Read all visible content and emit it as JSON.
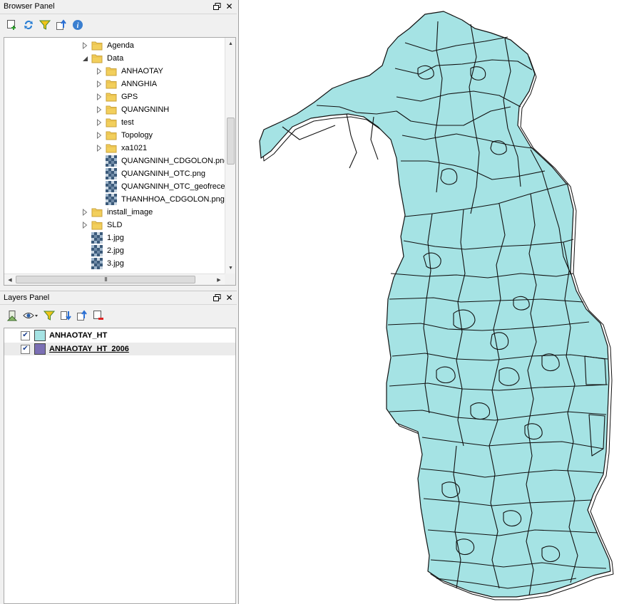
{
  "browser_panel": {
    "title": "Browser Panel",
    "float_icon": "float-icon",
    "close_icon": "close-icon",
    "tools": [
      "add-layer-icon",
      "refresh-icon",
      "filter-icon",
      "collapse-all-icon",
      "info-icon"
    ],
    "tree": [
      {
        "label": "Agenda",
        "type": "folder",
        "depth": 0,
        "expander": "collapsed"
      },
      {
        "label": "Data",
        "type": "folder",
        "depth": 0,
        "expander": "expanded"
      },
      {
        "label": "ANHAOTAY",
        "type": "folder",
        "depth": 1,
        "expander": "collapsed"
      },
      {
        "label": "ANNGHIA",
        "type": "folder",
        "depth": 1,
        "expander": "collapsed"
      },
      {
        "label": "GPS",
        "type": "folder",
        "depth": 1,
        "expander": "collapsed"
      },
      {
        "label": "QUANGNINH",
        "type": "folder",
        "depth": 1,
        "expander": "collapsed"
      },
      {
        "label": "test",
        "type": "folder",
        "depth": 1,
        "expander": "collapsed"
      },
      {
        "label": "Topology",
        "type": "folder",
        "depth": 1,
        "expander": "collapsed"
      },
      {
        "label": "xa1021",
        "type": "folder",
        "depth": 1,
        "expander": "collapsed"
      },
      {
        "label": "QUANGNINH_CDGOLON.png",
        "type": "raster",
        "depth": 1,
        "expander": "none"
      },
      {
        "label": "QUANGNINH_OTC.png",
        "type": "raster",
        "depth": 1,
        "expander": "none"
      },
      {
        "label": "QUANGNINH_OTC_geofrecen",
        "type": "raster",
        "depth": 1,
        "expander": "none"
      },
      {
        "label": "THANHHOA_CDGOLON.png",
        "type": "raster",
        "depth": 1,
        "expander": "none"
      },
      {
        "label": "install_image",
        "type": "folder",
        "depth": -1,
        "expander": "collapsed"
      },
      {
        "label": "SLD",
        "type": "folder",
        "depth": -1,
        "expander": "collapsed"
      },
      {
        "label": "1.jpg",
        "type": "raster",
        "depth": -1,
        "expander": "none"
      },
      {
        "label": "2.jpg",
        "type": "raster",
        "depth": -1,
        "expander": "none"
      },
      {
        "label": "3.jpg",
        "type": "raster",
        "depth": -1,
        "expander": "none"
      }
    ],
    "hscroll_grip": "III"
  },
  "layers_panel": {
    "title": "Layers Panel",
    "tools": [
      "style-manager-icon",
      "visibility-eye-icon",
      "filter-legend-icon",
      "expand-all-icon",
      "collapse-all-icon",
      "remove-layer-icon"
    ],
    "layers": [
      {
        "label": "ANHAOTAY_HT",
        "color": "#a5e3e4",
        "checked": true,
        "selected": false
      },
      {
        "label": "ANHAOTAY_HT_2006",
        "color": "#7b6fb4",
        "checked": true,
        "selected": true
      }
    ]
  },
  "map": {
    "fill_color": "#a5e3e4",
    "stroke_color": "#111111"
  }
}
